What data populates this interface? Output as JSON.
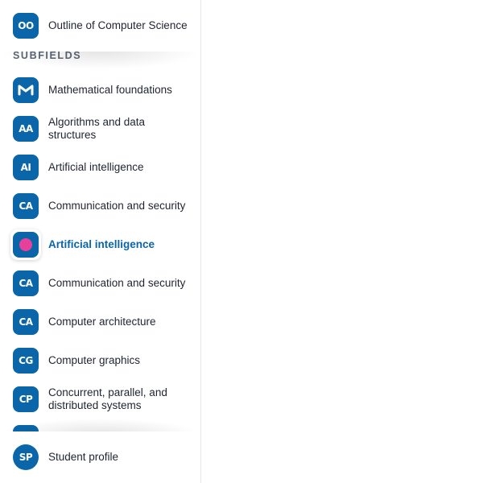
{
  "outline": {
    "badge": "OO",
    "label": "Outline of Computer Science"
  },
  "section_label": "SUBFIELDS",
  "items": [
    {
      "badge": "M",
      "label": "Mathematical foundations"
    },
    {
      "badge": "AA",
      "label": "Algorithms and data structures"
    },
    {
      "badge": "AI",
      "label": "Artificial intelligence"
    },
    {
      "badge": "CA",
      "label": "Communication and security"
    },
    {
      "badge": "",
      "label": "Artificial intelligence",
      "active": true
    },
    {
      "badge": "CA",
      "label": "Communication and security"
    },
    {
      "badge": "CA",
      "label": "Computer architecture"
    },
    {
      "badge": "CG",
      "label": "Computer graphics"
    },
    {
      "badge": "CP",
      "label": "Concurrent, parallel, and distributed systems"
    }
  ],
  "footer": {
    "badge": "SP",
    "label": "Student profile"
  },
  "colors": {
    "badge": "#0a66a8",
    "active_text": "#0a66a8",
    "active_dot": "#e8409a",
    "section_label": "#5b6573"
  }
}
